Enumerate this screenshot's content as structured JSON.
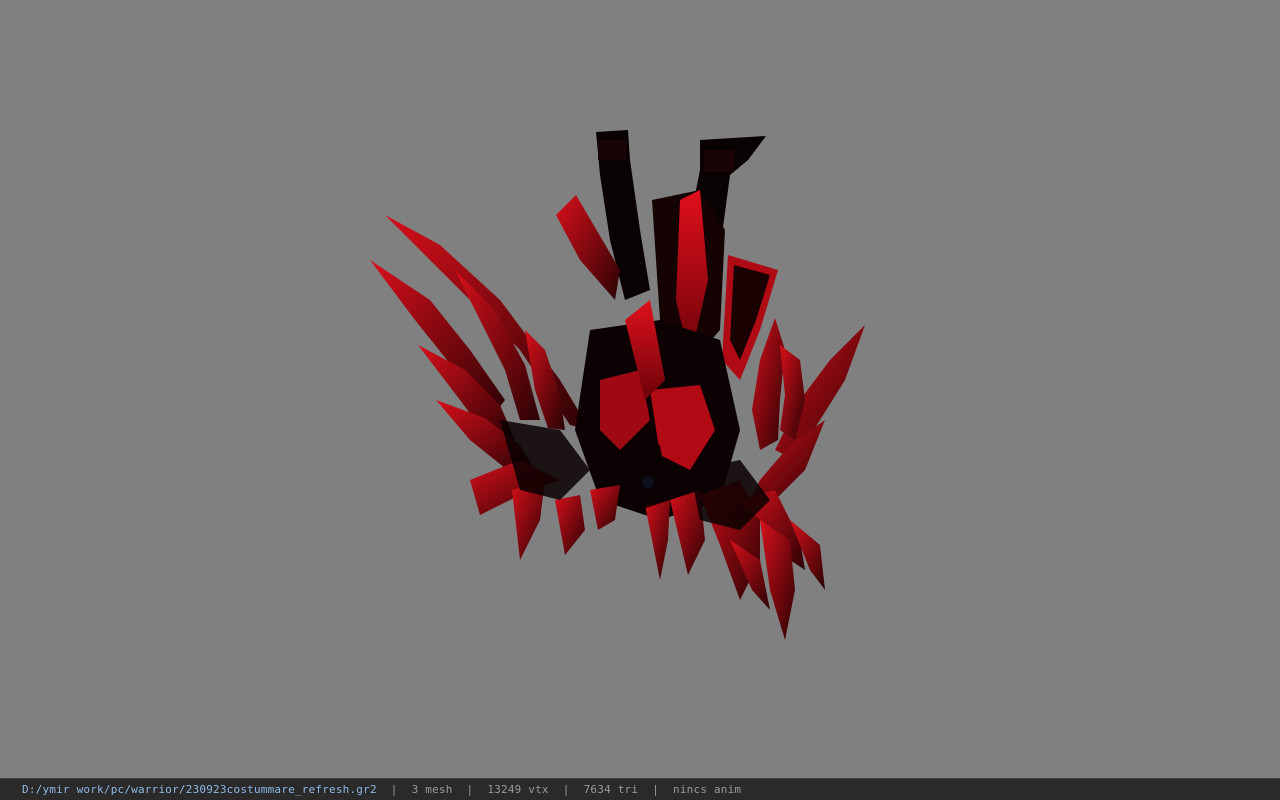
{
  "viewer": {
    "background_color": "#808080",
    "model_name": "230923costummare_refresh"
  },
  "status": {
    "file_path": "D:/ymir work/pc/warrior/230923costummare_refresh.gr2",
    "mesh_count": "3 mesh",
    "vertex_count": "13249 vtx",
    "triangle_count": "7634 tri",
    "anim_status": "nincs anim",
    "separator": "|"
  },
  "colors": {
    "model_red": "#d0101a",
    "model_dark": "#080203",
    "accent_blue": "#3a6ed8",
    "status_bg": "#2a2a2a",
    "path_text": "#8fb8e6"
  }
}
